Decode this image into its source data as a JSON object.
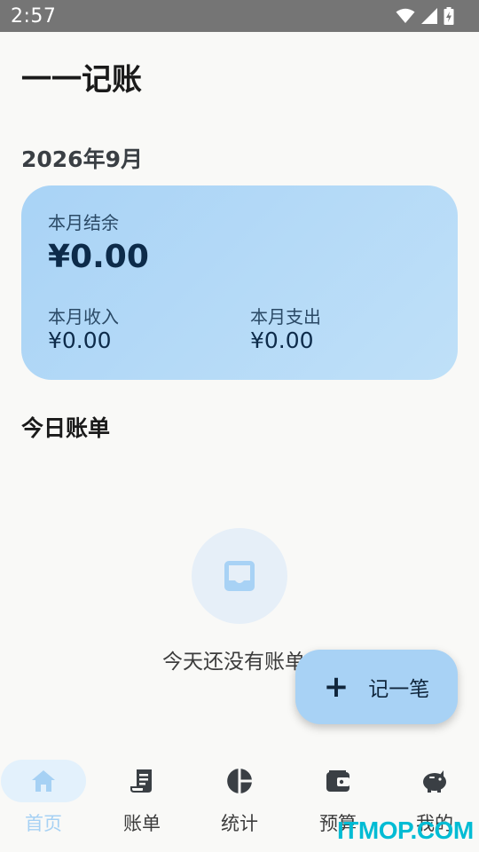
{
  "status_bar": {
    "time": "2:57"
  },
  "app": {
    "title": "一一记账"
  },
  "month": {
    "label": "2026年9月"
  },
  "summary": {
    "balance_label": "本月结余",
    "balance_value": "¥0.00",
    "income_label": "本月收入",
    "income_value": "¥0.00",
    "expense_label": "本月支出",
    "expense_value": "¥0.00"
  },
  "today": {
    "title": "今日账单",
    "empty_text": "今天还没有账单"
  },
  "fab": {
    "label": "记一笔"
  },
  "nav": {
    "items": [
      {
        "label": "首页",
        "icon": "home-icon",
        "active": true
      },
      {
        "label": "账单",
        "icon": "receipt-icon",
        "active": false
      },
      {
        "label": "统计",
        "icon": "pie-chart-icon",
        "active": false
      },
      {
        "label": "预算",
        "icon": "wallet-icon",
        "active": false
      },
      {
        "label": "我的",
        "icon": "piggy-bank-icon",
        "active": false
      }
    ]
  },
  "watermark": {
    "text": "ITMOP.COM"
  },
  "colors": {
    "accent": "#a8d2f5",
    "card_start": "#a9d3f6",
    "card_end": "#bfe0f8",
    "nav_active": "#a6d1f4",
    "status_bar": "#757575"
  }
}
